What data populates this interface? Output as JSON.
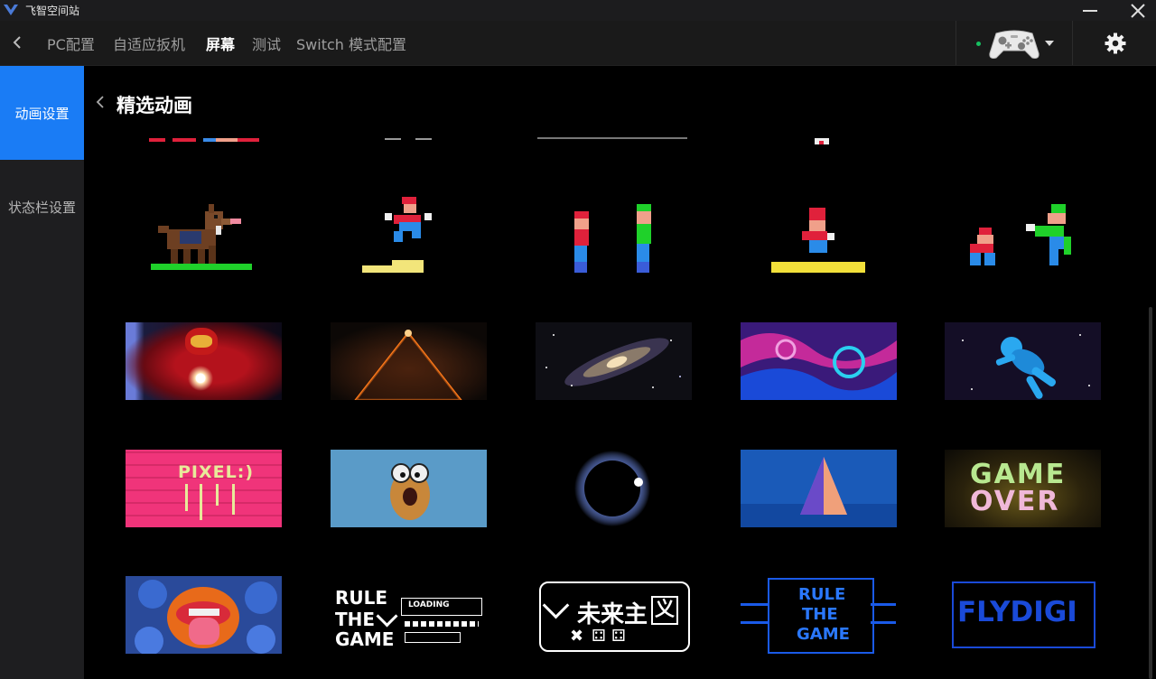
{
  "app": {
    "title": "飞智空间站"
  },
  "nav": {
    "tabs": [
      {
        "label": "PC配置",
        "active": false
      },
      {
        "label": "自适应扳机",
        "active": false
      },
      {
        "label": "屏幕",
        "active": true
      },
      {
        "label": "测试",
        "active": false
      },
      {
        "label": "Switch 模式配置",
        "active": false
      }
    ],
    "status_color": "#16c060"
  },
  "sidebar": {
    "items": [
      {
        "label": "动画设置",
        "active": true
      },
      {
        "label": "状态栏设置",
        "active": false
      }
    ],
    "accent": "#1a7cf5"
  },
  "main": {
    "title": "精选动画",
    "rows": [
      {
        "kind": "partial-pixel",
        "items": [
          "partial-a",
          "partial-b",
          "partial-c",
          "partial-d"
        ]
      },
      {
        "kind": "pixel",
        "items": [
          "dog",
          "jumper",
          "twins",
          "platform",
          "brothers"
        ]
      },
      {
        "kind": "photo",
        "items": [
          "iron-man",
          "glowing-pyramid",
          "galaxy",
          "purple-swirl",
          "astronaut"
        ]
      },
      {
        "kind": "photo",
        "items": [
          "pixel-wall",
          "cartoon-egg",
          "eclipse",
          "crystal-pyramid",
          "game-over-sign"
        ]
      },
      {
        "kind": "graphic",
        "items": [
          "tongue-art",
          "rule-the-game-white",
          "future-master",
          "rule-the-game-blue",
          "flydigi-logo"
        ]
      }
    ],
    "thumb_text": {
      "pixel_wall": "PIXEL:)",
      "game_over_1": "GAME",
      "game_over_2": "OVER",
      "rule_1": "RULE",
      "rule_2": "THE",
      "rule_3": "GAME",
      "loading": "LOADING",
      "future": "未来主",
      "future_box": "义",
      "flydigi": "FLYDIGI"
    }
  }
}
